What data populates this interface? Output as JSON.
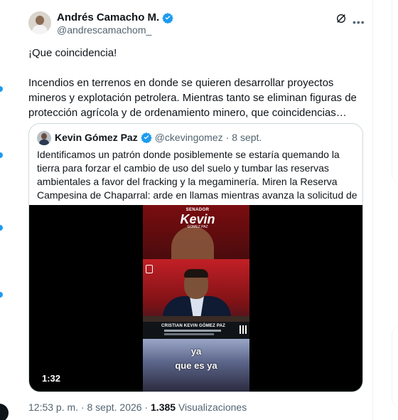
{
  "author": {
    "display_name": "Andrés Camacho M.",
    "handle": "@andrescamachom_"
  },
  "tweet": {
    "line1": "¡Que coincidencia!",
    "line2": "Incendios en terrenos en donde se quieren desarrollar proyectos mineros y explotación petrolera. Mientras tanto se eliminan figuras de protección agrícola y de ordenamiento minero, que coincidencias…"
  },
  "quote": {
    "display_name": "Kevin Gómez Paz",
    "handle": "@ckevingomez",
    "separator": "·",
    "date": "8 sept.",
    "text": "Identificamos un patrón donde posiblemente se estaría quemando la tierra para forzar el cambio de uso del suelo y tumbar las reservas ambientales a favor del fracking y la megaminería. Miren la Reserva Campesina de Chaparral: arde en llamas mientras avanza la solicitud de título",
    "video": {
      "duration": "1:32",
      "logo_small": "SENADOR",
      "logo_big": "Kevin",
      "logo_tail": "GOMEZ PAZ",
      "lower_third_name": "CRISTIAN KEVIN GÓMEZ PAZ",
      "subtitle_line1": "ya",
      "subtitle_line2": "que es ya"
    }
  },
  "meta": {
    "time": "12:53 p. m.",
    "separator": "·",
    "date": "8 sept. 2026",
    "views_count": "1.385",
    "views_label": "Visualizaciones"
  },
  "colors": {
    "verified": "#1d9bf0",
    "text_primary": "#0f1419",
    "text_secondary": "#536471",
    "border": "#cfd9de"
  },
  "icons": {
    "verified": "verified-badge-icon",
    "grok": "grok-icon",
    "more": "more-options-icon"
  }
}
